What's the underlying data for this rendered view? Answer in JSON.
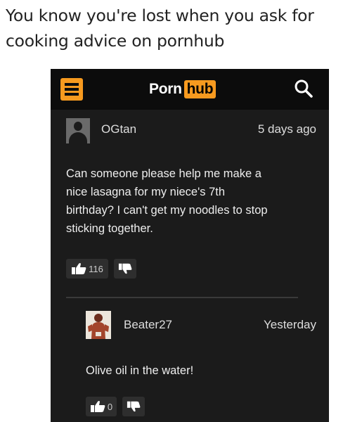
{
  "caption": {
    "line1": "You know you're lost when you ask for",
    "line2": "cooking advice on pornhub"
  },
  "header": {
    "logo_part1": "Porn",
    "logo_part2": "hub",
    "accent_color": "#f79a1f",
    "menu_icon": "hamburger-menu-icon",
    "search_icon": "search-icon"
  },
  "comments": [
    {
      "username": "OGtan",
      "time": "5 days ago",
      "text": [
        "Can someone please help me make a",
        "nice lasagna for my niece's 7th",
        "birthday? I can't get my noodles to stop",
        "sticking together."
      ],
      "likes": "116"
    },
    {
      "username": "Beater27",
      "time": "Yesterday",
      "text": [
        "Olive oil in the water!"
      ],
      "likes": "0"
    }
  ]
}
